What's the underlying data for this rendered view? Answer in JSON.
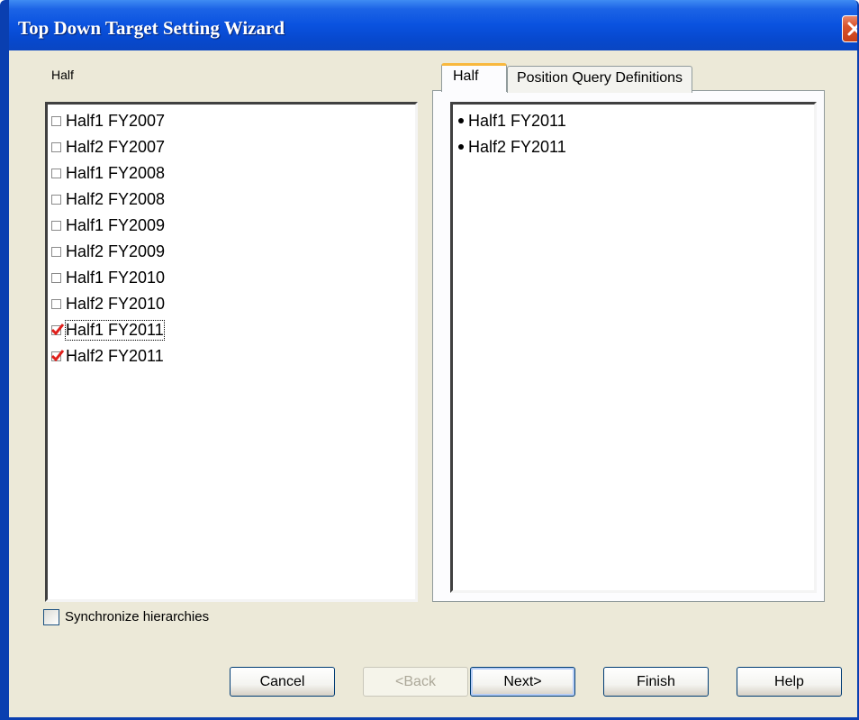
{
  "window": {
    "title": "Top Down Target Setting Wizard"
  },
  "left_panel": {
    "label": "Half",
    "items": [
      {
        "label": "Half1 FY2007",
        "checked": false
      },
      {
        "label": "Half2 FY2007",
        "checked": false
      },
      {
        "label": "Half1 FY2008",
        "checked": false
      },
      {
        "label": "Half2 FY2008",
        "checked": false
      },
      {
        "label": "Half1 FY2009",
        "checked": false
      },
      {
        "label": "Half2 FY2009",
        "checked": false
      },
      {
        "label": "Half1 FY2010",
        "checked": false
      },
      {
        "label": "Half2 FY2010",
        "checked": false
      },
      {
        "label": "Half1 FY2011",
        "checked": true,
        "focused": true
      },
      {
        "label": "Half2 FY2011",
        "checked": true
      }
    ]
  },
  "tabs": [
    {
      "label": "Half",
      "active": true
    },
    {
      "label": "Position Query Definitions",
      "active": false
    }
  ],
  "right_panel": {
    "items": [
      "Half1 FY2011",
      "Half2 FY2011"
    ]
  },
  "sync": {
    "label": "Synchronize hierarchies",
    "checked": false
  },
  "buttons": {
    "cancel": "Cancel",
    "back": "<Back",
    "next": "Next>",
    "finish": "Finish",
    "help": "Help"
  },
  "colors": {
    "title_bar": "#0a52df",
    "dialog_bg": "#ece9d8",
    "check_mark": "#e0201c",
    "close_button": "#d9542b",
    "tab_highlight": "#f8b83e"
  },
  "icons": {
    "close": "close-icon",
    "check": "checkmark-icon",
    "bullet": "bullet-icon"
  }
}
